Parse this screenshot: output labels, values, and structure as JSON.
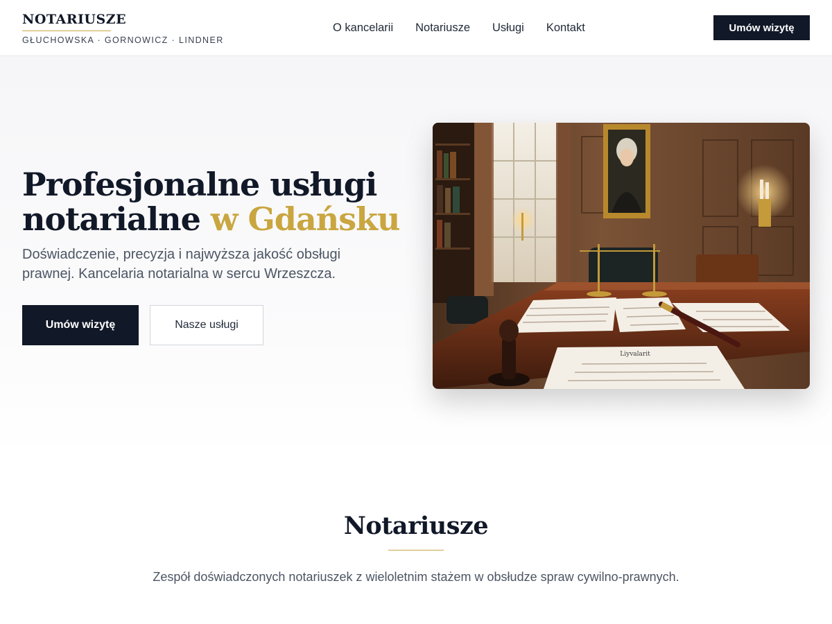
{
  "header": {
    "logo_title": "NOTARIUSZE",
    "logo_subtitle": "GŁUCHOWSKA · GORNOWICZ · LINDNER",
    "nav": [
      "O kancelarii",
      "Notariusze",
      "Usługi",
      "Kontakt"
    ],
    "cta_label": "Umów wizytę"
  },
  "hero": {
    "title_line1": "Profesjonalne usługi",
    "title_line2_main": "notarialne ",
    "title_line2_accent": "w Gdańsku",
    "subtitle": "Doświadczenie, precyzja i najwyższa jakość obsługi prawnej. Kancelaria notarialna w sercu Wrzeszcza.",
    "primary_button": "Umów wizytę",
    "secondary_button": "Nasze usługi",
    "image_document_heading": "Liyvalarit"
  },
  "section": {
    "title": "Notariusze",
    "description": "Zespół doświadczonych notariuszek z wieloletnim stażem w obsłudze spraw cywilno-prawnych."
  },
  "colors": {
    "accent": "#c9a640",
    "dark": "#111827",
    "text_muted": "#4b5563"
  }
}
